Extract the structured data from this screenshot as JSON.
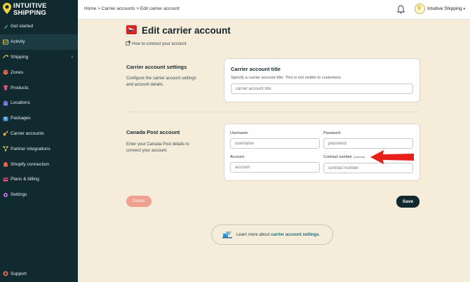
{
  "brand": {
    "line1": "INTUITIVE",
    "line2": "SHIPPING"
  },
  "sidebar": {
    "items": [
      {
        "label": "Get started",
        "icon": "rocket-icon",
        "color": "#4fb3d9"
      },
      {
        "label": "Activity",
        "icon": "activity-icon",
        "color": "#e0c84a",
        "active": true
      },
      {
        "label": "Shipping",
        "icon": "shipping-icon",
        "color": "#e0c84a",
        "chevron": "›"
      },
      {
        "label": "Zones",
        "icon": "globe-icon",
        "color": "#e86b4a"
      },
      {
        "label": "Products",
        "icon": "shirt-icon",
        "color": "#e8507a"
      },
      {
        "label": "Locations",
        "icon": "building-icon",
        "color": "#8a7be0"
      },
      {
        "label": "Packages",
        "icon": "box-icon",
        "color": "#4a9be0"
      },
      {
        "label": "Carrier accounts",
        "icon": "key-icon",
        "color": "#e0a84a"
      },
      {
        "label": "Partner integrations",
        "icon": "integration-icon",
        "color": "#e0c84a"
      },
      {
        "label": "Shopify connection",
        "icon": "shopify-icon",
        "color": "#e86b4a"
      },
      {
        "label": "Plans & billing",
        "icon": "billing-icon",
        "color": "#e8507a"
      },
      {
        "label": "Settings",
        "icon": "gear-icon",
        "color": "#c86be0"
      }
    ],
    "support_label": "Support"
  },
  "topbar": {
    "breadcrumb": "Home > Carrier accounts > Edit carrier account",
    "account_name": "Intuitive Shipping",
    "account_caret": "▾"
  },
  "page": {
    "title": "Edit carrier account",
    "howto_link": "How to connect your account"
  },
  "settings_section": {
    "heading": "Carrier account settings",
    "description": "Configure the carrier account settings and account details.",
    "card_title": "Carrier account title",
    "card_subtitle": "Specify a carrier account title. This is not visible to customers.",
    "title_placeholder": "carrier account title"
  },
  "canada_section": {
    "heading": "Canada Post account",
    "description": "Enter your Canada Post details to connect your account.",
    "username_label": "Username",
    "username_placeholder": "username",
    "password_label": "Password",
    "password_placeholder": "password",
    "account_label": "Account",
    "account_placeholder": "account",
    "contract_label": "Contract number",
    "contract_optional": "(Optional)",
    "contract_placeholder": "contract number"
  },
  "actions": {
    "delete_label": "Delete",
    "save_label": "Save"
  },
  "learn_more": {
    "text": "Learn more about",
    "link": "carrier account settings."
  },
  "colors": {
    "sidebar_bg": "#102a30",
    "page_bg": "#f5ecd9",
    "delete_bg": "#f0a08e",
    "save_bg": "#102a30",
    "arrow": "#e8201a",
    "link": "#1d6d7a"
  }
}
